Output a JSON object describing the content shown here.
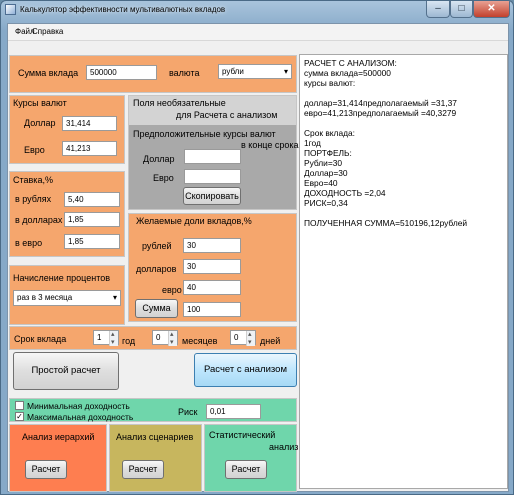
{
  "window": {
    "title": "Калькулятор эффективности мультивалютных вкладов",
    "minimize_glyph": "–",
    "maximize_glyph": "□",
    "close_glyph": "✕"
  },
  "menu": [
    "Файл",
    "Справка"
  ],
  "deposit": {
    "label": "Сумма вклада",
    "value": "500000",
    "currency_label": "валюта",
    "currency_value": "рубли"
  },
  "rates": {
    "title": "Курсы валют",
    "dollar_label": "Доллар",
    "dollar_value": "31,414",
    "euro_label": "Евро",
    "euro_value": "41,213"
  },
  "optional": {
    "title1": "Поля необязательные",
    "title2": "для Расчета с анализом",
    "expected_title": "Предположительные курсы валют",
    "end_of_term": "в конце срока",
    "dollar_label": "Доллар",
    "euro_label": "Евро",
    "dollar_value": "",
    "euro_value": "",
    "copy_button": "Скопировать"
  },
  "stake": {
    "title": "Ставка,%",
    "rub_label": "в рублях",
    "rub_value": "5,40",
    "usd_label": "в долларах",
    "usd_value": "1,85",
    "eur_label": "в евро",
    "eur_value": "1,85"
  },
  "shares": {
    "title": "Желаемые доли вкладов,%",
    "rub_label": "рублей",
    "rub_value": "30",
    "usd_label": "долларов",
    "usd_value": "30",
    "eur_label": "евро",
    "eur_value": "40",
    "sum_button": "Сумма",
    "sum_value": "100"
  },
  "interest": {
    "title": "Начисление процентов",
    "value": "раз в 3 месяца"
  },
  "term": {
    "label": "Срок вклада",
    "years": "1",
    "years_label": "год",
    "months": "0",
    "months_label": "месяцев",
    "days": "0",
    "days_label": "дней"
  },
  "buttons": {
    "simple": "Простой расчет",
    "analysis": "Расчет с анализом"
  },
  "risk": {
    "min_label": "Минимальная доходность",
    "min_checked": "",
    "max_label": "Максимальная доходность",
    "max_checked": "✓",
    "risk_label": "Риск",
    "risk_value": "0,01"
  },
  "analysis": {
    "hier_title": "Анализ иерархий",
    "scen_title": "Анализ сценариев",
    "stat_title1": "Статистический",
    "stat_title2": "анализ",
    "calc_button": "Расчет"
  },
  "output_lines": [
    "РАСЧЕТ С АНАЛИЗОМ:",
    " сумма вклада=500000",
    "курсы валют:",
    "",
    "доллар=31,414предполагаемый =31,37",
    "евро=41,213предполагаемый =40,3279",
    "",
    "Срок вклада:",
    "1год",
    "ПОРТФЕЛЬ:",
    "Рубли=30",
    "Доллар=30",
    "Евро=40",
    "ДОХОДНОСТЬ =2,04",
    "РИСК=0,34",
    "",
    "ПОЛУЧЕННАЯ СУММА=510196,12рублей"
  ],
  "colors": {
    "orange": "#f5a66d",
    "gray": "#a9a9a9",
    "green": "#6fd6ab",
    "hier": "#fe7e50",
    "scen": "#c7b65e"
  }
}
